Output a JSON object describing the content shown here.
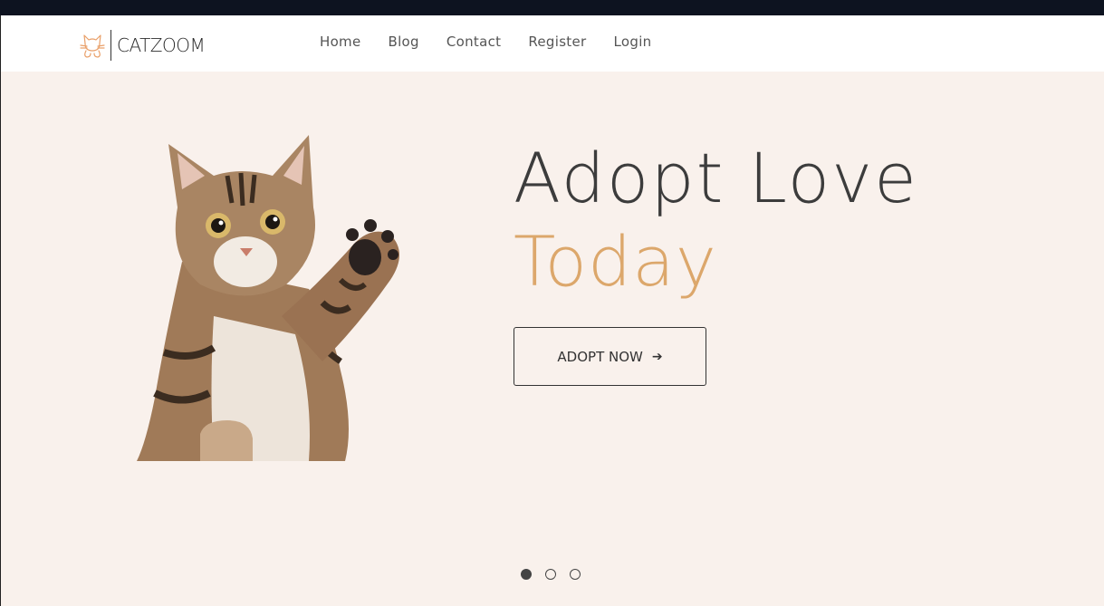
{
  "brand": {
    "logo_text": "CATZOOM",
    "accent": "#e9a06a"
  },
  "nav": {
    "items": [
      {
        "label": "Home"
      },
      {
        "label": "Blog"
      },
      {
        "label": "Contact"
      },
      {
        "label": "Register"
      },
      {
        "label": "Login"
      }
    ]
  },
  "hero": {
    "title_line1": "Adopt Love",
    "title_line2": "Today",
    "title_line2_color": "#dca76b",
    "cta_label": "ADOPT NOW",
    "cta_icon": "arrow-right-icon",
    "background": "#f9f1ec"
  },
  "carousel": {
    "slide_count": 3,
    "active_index": 0
  }
}
